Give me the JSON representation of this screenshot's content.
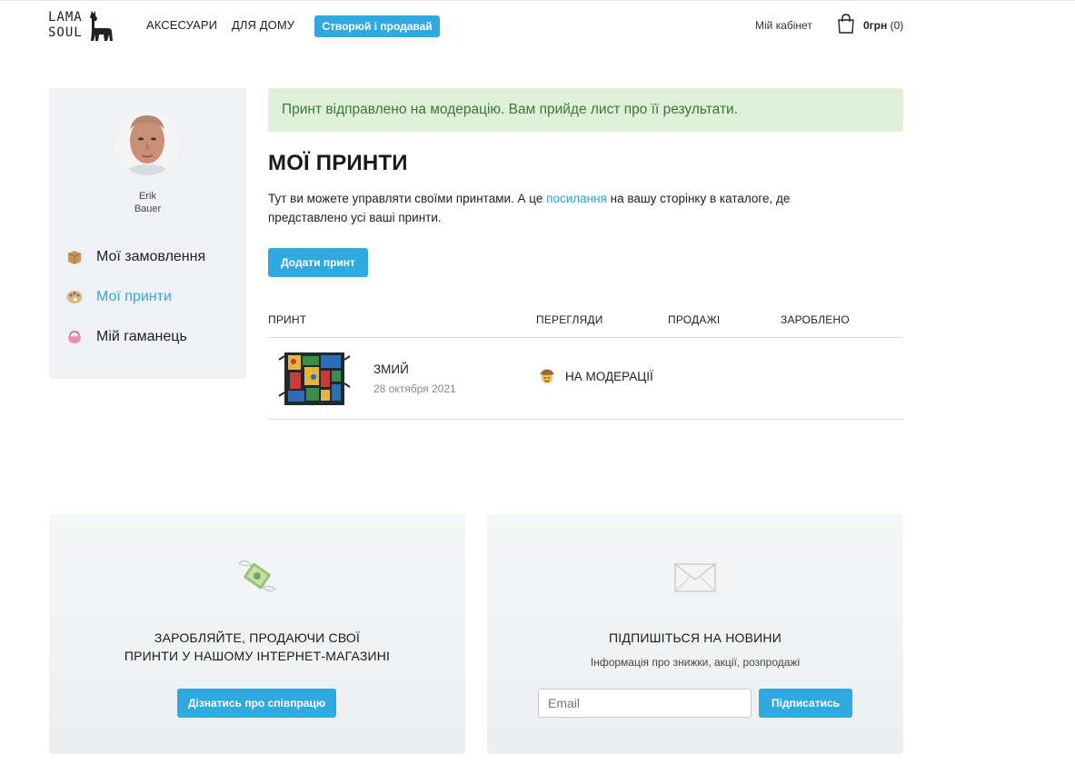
{
  "header": {
    "logo_line1": "LAMA",
    "logo_line2": "SOUL",
    "nav": [
      "АКСЕСУАРИ",
      "ДЛЯ ДОМУ"
    ],
    "create_button": "Створюй і продавай",
    "account": "Мій кабінет",
    "cart_amount": "0грн",
    "cart_count": "(0)",
    "accent": "#30a9e0"
  },
  "sidebar": {
    "user_first": "Erik",
    "user_last": "Bauer",
    "items": [
      {
        "label": "Мої замовлення",
        "icon": "package-icon"
      },
      {
        "label": "Мої принти",
        "icon": "palette-icon",
        "active": true
      },
      {
        "label": "Мій гаманець",
        "icon": "purse-icon"
      }
    ]
  },
  "main": {
    "alert": "Принт відправлено на модерацію. Вам прийде лист про її результати.",
    "title": "МОЇ ПРИНТИ",
    "intro_before": "Тут ви можете управляти своїми принтами. А це ",
    "intro_link": "посилання",
    "intro_after": " на вашу сторінку в каталоге, де представлено усі ваші принти.",
    "add_button": "Додати принт",
    "columns": [
      "ПРИНТ",
      "ПЕРЕГЛЯДИ",
      "ПРОДАЖІ",
      "ЗАРОБЛЕНО"
    ],
    "rows": [
      {
        "name": "ЗМИЙ",
        "date": "28 октября 2021",
        "status": "НА МОДЕРАЦІЇ",
        "status_icon": "cowboy-face-icon"
      }
    ]
  },
  "footer": {
    "earn_line1": "ЗАРОБЛЯЙТЕ, ПРОДАЮЧИ СВОЇ",
    "earn_line2": "ПРИНТИ У НАШОМУ ІНТЕРНЕТ-МАГАЗИНІ",
    "earn_button": "Дізнатись про співпрацю",
    "subscribe_title": "ПІДПИШІТЬСЯ НА НОВИНИ",
    "subscribe_sub": "Інформація про знижки, акції, розпродажі",
    "email_placeholder": "Email",
    "subscribe_button": "Підписатись"
  }
}
